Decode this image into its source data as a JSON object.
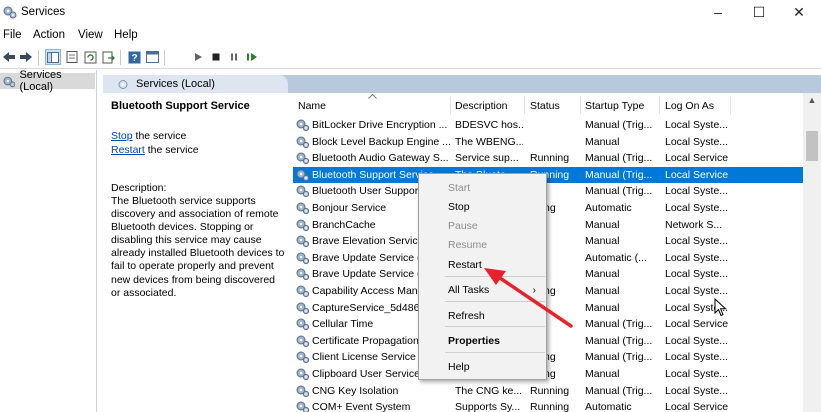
{
  "window": {
    "title": "Services",
    "controls": {
      "minimize": "–",
      "maximize": "☐",
      "close": "✕"
    }
  },
  "menu": [
    "File",
    "Action",
    "View",
    "Help"
  ],
  "tree": {
    "item": "Services (Local)"
  },
  "panel": {
    "tab_label": "Services (Local)"
  },
  "description_pane": {
    "service_name": "Bluetooth Support Service",
    "stop_link": "Stop",
    "stop_suffix": " the service",
    "restart_link": "Restart",
    "restart_suffix": " the service",
    "description_label": "Description:",
    "description_lines": [
      "The Bluetooth service supports",
      "discovery and association of remote",
      "Bluetooth devices.  Stopping or",
      "disabling this service may cause",
      "already installed Bluetooth devices to",
      "fail to operate properly and prevent",
      "new devices from being discovered",
      "or associated."
    ]
  },
  "table": {
    "columns": [
      "Name",
      "Description",
      "Status",
      "Startup Type",
      "Log On As"
    ],
    "selected_index": 3,
    "rows": [
      [
        "BitLocker Drive Encryption ...",
        "BDESVC hos...",
        "",
        "Manual (Trig...",
        "Local Syste..."
      ],
      [
        "Block Level Backup Engine ...",
        "The WBENG...",
        "",
        "Manual",
        "Local Syste..."
      ],
      [
        "Bluetooth Audio Gateway S...",
        "Service sup...",
        "Running",
        "Manual (Trig...",
        "Local Service"
      ],
      [
        "Bluetooth Support Service",
        "The Blueto...",
        "Running",
        "Manual (Trig...",
        "Local Service"
      ],
      [
        "Bluetooth User Suppor",
        "",
        "",
        "Manual (Trig...",
        "Local Syste..."
      ],
      [
        "Bonjour Service",
        "",
        "nning",
        "Automatic",
        "Local Syste..."
      ],
      [
        "BranchCache",
        "",
        "",
        "Manual",
        "Network S..."
      ],
      [
        "Brave Elevation Service",
        "",
        "",
        "Manual",
        "Local Syste..."
      ],
      [
        "Brave Update Service (I",
        "",
        "",
        "Automatic (...",
        "Local Syste..."
      ],
      [
        "Brave Update Service (I",
        "",
        "",
        "Manual",
        "Local Syste..."
      ],
      [
        "Capability Access Man",
        "",
        "nning",
        "Manual",
        "Local Syste..."
      ],
      [
        "CaptureService_5d486",
        "",
        "",
        "Manual",
        "Local Syste..."
      ],
      [
        "Cellular Time",
        "",
        "",
        "Manual (Trig...",
        "Local Service"
      ],
      [
        "Certificate Propagation",
        "",
        "",
        "Manual (Trig...",
        "Local Syste..."
      ],
      [
        "Client License Service (",
        "",
        "nning",
        "Manual (Trig...",
        "Local Syste..."
      ],
      [
        "Clipboard User Service_",
        "",
        "nning",
        "Manual",
        "Local Syste..."
      ],
      [
        "CNG Key Isolation",
        "The CNG ke...",
        "Running",
        "Manual (Trig...",
        "Local Syste..."
      ],
      [
        "COM+ Event System",
        "Supports Sy...",
        "Running",
        "Automatic",
        "Local Service"
      ]
    ]
  },
  "context_menu": {
    "items": [
      {
        "label": "Start",
        "enabled": false
      },
      {
        "label": "Stop",
        "enabled": true
      },
      {
        "label": "Pause",
        "enabled": false
      },
      {
        "label": "Resume",
        "enabled": false
      },
      {
        "label": "Restart",
        "enabled": true
      },
      {
        "label": "All Tasks",
        "enabled": true,
        "submenu": "›"
      },
      {
        "label": "Refresh",
        "enabled": true
      },
      {
        "label": "Properties",
        "enabled": true,
        "bold": true
      },
      {
        "label": "Help",
        "enabled": true
      }
    ]
  },
  "colors": {
    "selection": "#0078d7",
    "annotation_arrow": "#e8222a",
    "link": "#0645ad",
    "panel_header": "#b8c9de"
  },
  "icons": [
    "services-gear-icon",
    "back-arrow-icon",
    "forward-arrow-icon",
    "play-icon",
    "stop-icon",
    "pause-icon",
    "restart-icon"
  ]
}
